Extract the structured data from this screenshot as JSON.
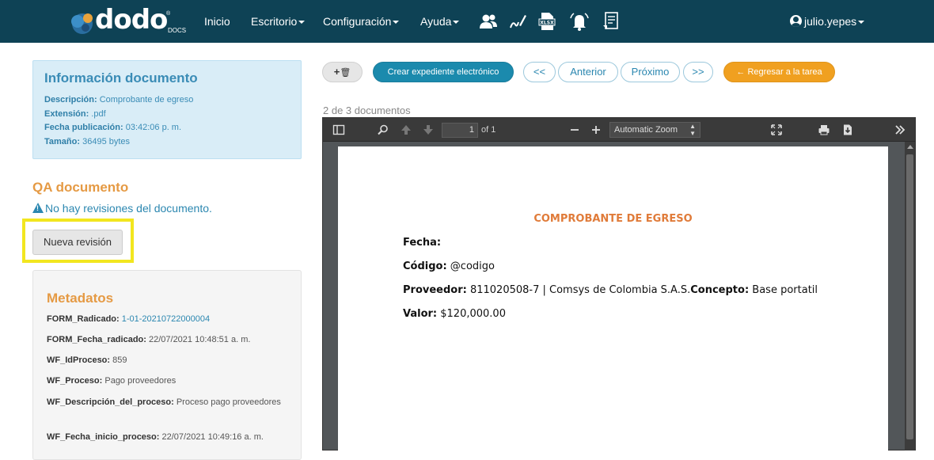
{
  "navbar": {
    "logo_text": "dodo",
    "logo_sub": "DOCS",
    "logo_reg": "®",
    "items": [
      {
        "label": "Inicio"
      },
      {
        "label": "Escritorio"
      },
      {
        "label": "Configuración"
      },
      {
        "label": "Ayuda"
      }
    ],
    "icons": [
      "users-icon",
      "signature-icon",
      "xlsx-file-icon",
      "bell-icon",
      "document-list-icon"
    ],
    "user": "julio.yepes"
  },
  "info": {
    "title": "Información documento",
    "description_label": "Descripción:",
    "description_value": "Comprobante de egreso",
    "extension_label": "Extensión:",
    "extension_value": ".pdf",
    "published_label": "Fecha publicación:",
    "published_value": "03:42:06 p. m.",
    "size_label": "Tamaño:",
    "size_value": "36495 bytes"
  },
  "qa": {
    "title": "QA documento",
    "warning": "No hay revisiones del documento.",
    "button": "Nueva revisión"
  },
  "metadata": {
    "title": "Metadatos",
    "items": [
      {
        "key": "FORM_Radicado:",
        "value": "1-01-20210722000004"
      },
      {
        "key": "FORM_Fecha_radicado:",
        "value": "22/07/2021 10:48:51 a. m."
      },
      {
        "key": "WF_IdProceso:",
        "value": "859"
      },
      {
        "key": "WF_Proceso:",
        "value": "Pago proveedores"
      },
      {
        "key": "WF_Descripción_del_proceso:",
        "value": "Proceso pago proveedores"
      },
      {
        "key": "WF_Fecha_inicio_proceso:",
        "value": "22/07/2021 10:49:16 a. m."
      }
    ]
  },
  "toolbar": {
    "add_label": "+",
    "trash_label": "🗑",
    "create_label": "Crear expediente electrónico",
    "first_label": "<<",
    "prev_label": "Anterior",
    "next_label": "Próximo",
    "last_label": ">>",
    "back_label": "← Regresar a la tarea"
  },
  "doc_count": "2 de 3 documentos",
  "viewer": {
    "page_value": "1",
    "page_of": "of 1",
    "zoom": "Automatic Zoom"
  },
  "pdf": {
    "title": "COMPROBANTE DE EGRESO",
    "fecha_label": "Fecha:",
    "codigo_label": "Código:",
    "codigo_value": " @codigo",
    "proveedor_label": "Proveedor:",
    "proveedor_value": " 811020508-7 | Comsys de Colombia S.A.S.",
    "concepto_label": "Concepto:",
    "concepto_value": " Base portatil",
    "valor_label": "Valor:",
    "valor_value": " $120,000.00"
  },
  "colors": {
    "navbar": "#0e4255",
    "accent_blue": "#1b8aad",
    "accent_orange": "#f0a020",
    "info_bg": "#d9edf7",
    "highlight": "#f2e61f",
    "pdf_title": "#e07b39"
  }
}
